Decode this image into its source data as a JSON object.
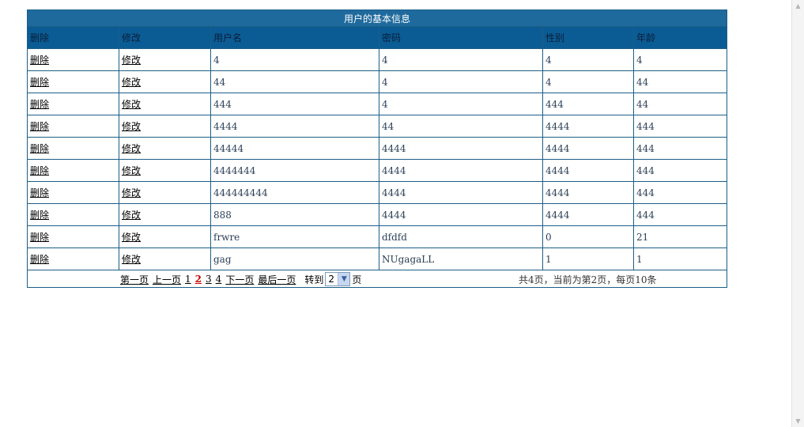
{
  "table": {
    "title": "用户的基本信息",
    "headers": [
      "删除",
      "修改",
      "用户名",
      "密码",
      "性别",
      "年龄"
    ],
    "delete_label": "删除",
    "edit_label": "修改",
    "rows": [
      {
        "username": "4",
        "password": "4",
        "gender": "4",
        "age": "4"
      },
      {
        "username": "44",
        "password": "4",
        "gender": "4",
        "age": "44"
      },
      {
        "username": "444",
        "password": "4",
        "gender": "444",
        "age": "44"
      },
      {
        "username": "4444",
        "password": "44",
        "gender": "4444",
        "age": "444"
      },
      {
        "username": "44444",
        "password": "4444",
        "gender": "4444",
        "age": "444"
      },
      {
        "username": "4444444",
        "password": "4444",
        "gender": "4444",
        "age": "444"
      },
      {
        "username": "444444444",
        "password": "4444",
        "gender": "4444",
        "age": "444"
      },
      {
        "username": "888",
        "password": "4444",
        "gender": "4444",
        "age": "444"
      },
      {
        "username": "frwre",
        "password": "dfdfd",
        "gender": "0",
        "age": "21"
      },
      {
        "username": "gag",
        "password": "NUgagaLL",
        "gender": "1",
        "age": "1"
      }
    ]
  },
  "pager": {
    "first": "第一页",
    "prev": "上一页",
    "pages": [
      "1",
      "2",
      "3",
      "4"
    ],
    "current": "2",
    "next": "下一页",
    "last": "最后一页",
    "goto_label": "转到",
    "goto_value": "2",
    "page_suffix": "页",
    "summary": "共4页，当前为第2页，每页10条"
  },
  "colors": {
    "title_bg": "#1f6a9d",
    "header_bg": "#0b5c94",
    "border": "#1d5e86",
    "current_page": "#cc0000"
  }
}
